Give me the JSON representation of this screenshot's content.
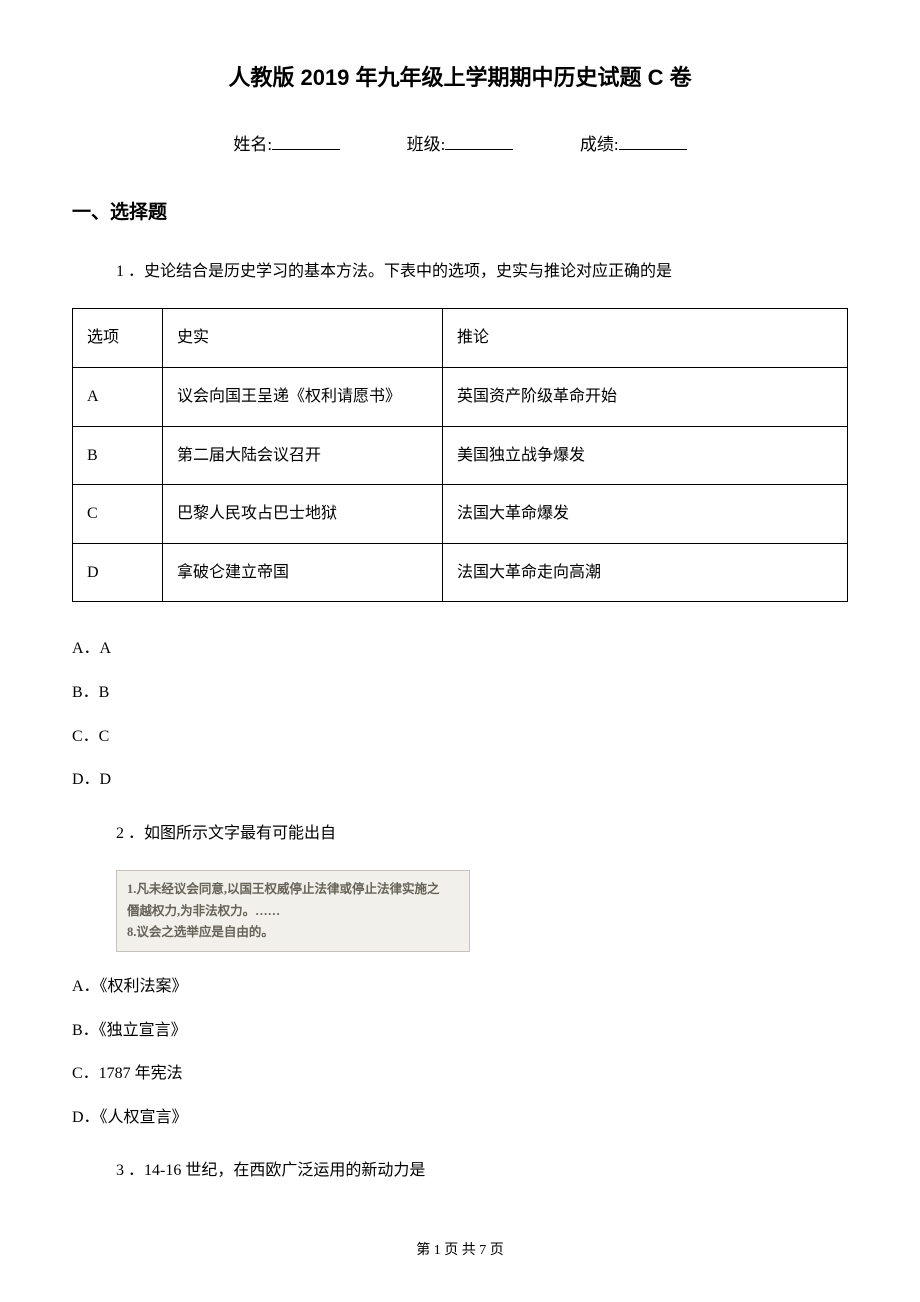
{
  "title": "人教版 2019 年九年级上学期期中历史试题 C 卷",
  "info": {
    "name_label": "姓名:",
    "class_label": "班级:",
    "score_label": "成绩:"
  },
  "section1_heading": "一、选择题",
  "q1": {
    "stem": "1 ．史论结合是历史学习的基本方法。下表中的选项，史实与推论对应正确的是",
    "headers": {
      "c1": "选项",
      "c2": "史实",
      "c3": "推论"
    },
    "rows": [
      {
        "opt": "A",
        "fact": "议会向国王呈递《权利请愿书》",
        "infer": "英国资产阶级革命开始"
      },
      {
        "opt": "B",
        "fact": "第二届大陆会议召开",
        "infer": "美国独立战争爆发"
      },
      {
        "opt": "C",
        "fact": "巴黎人民攻占巴士地狱",
        "infer": "法国大革命爆发"
      },
      {
        "opt": "D",
        "fact": "拿破仑建立帝国",
        "infer": "法国大革命走向高潮"
      }
    ],
    "answers": {
      "a": "A．A",
      "b": "B．B",
      "c": "C．C",
      "d": "D．D"
    }
  },
  "q2": {
    "stem": "2 ．如图所示文字最有可能出自",
    "img_line1": "1.凡未经议会同意,以国王权威停止法律或停止法律实施之",
    "img_line2": "僭越权力,为非法权力。……",
    "img_line3": "8.议会之选举应是自由的。",
    "answers": {
      "a": "A．《权利法案》",
      "b": "B．《独立宣言》",
      "c": "C．1787 年宪法",
      "d": "D．《人权宣言》"
    }
  },
  "q3": {
    "stem": "3 ．14-16 世纪，在西欧广泛运用的新动力是"
  },
  "footer": "第 1 页 共 7 页"
}
